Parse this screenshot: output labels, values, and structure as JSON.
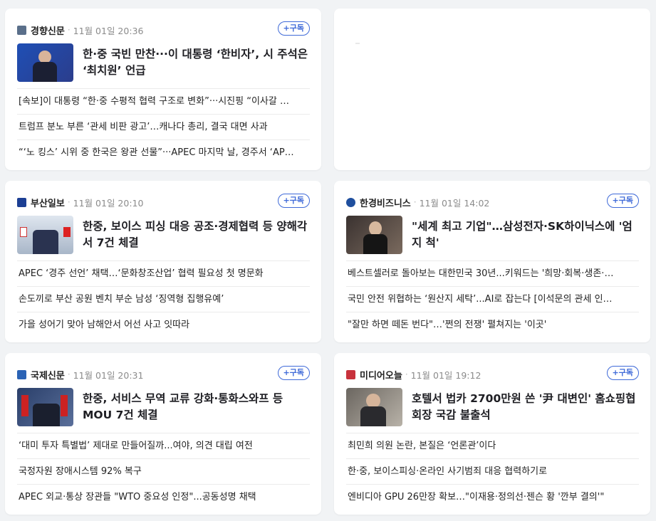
{
  "subscribe_label": "+구독",
  "cards": [
    {
      "press": "경향신문",
      "time": "11월 01일 20:36",
      "logo_color": "#5a6f8a",
      "thumb_colors": [
        "#1f4fb5",
        "#2b3d8c"
      ],
      "headline": "한·중 국빈 만찬···이 대통령 ‘한비자’, 시 주석은 ‘최치원’ 언급",
      "items": [
        "[속보]이 대통령 “한·중 수평적 협력 구조로 변화”···시진핑 “이사갈 …",
        "트럼프 분노 부른 ‘관세 비판 광고’…캐나다 총리, 결국 대면 사과",
        "“‘노 킹스’ 시위 중 한국은 왕관 선물”···APEC 마지막 날, 경주서 ‘AP…"
      ]
    },
    {
      "press": "부산일보",
      "time": "11월 01일 20:10",
      "logo_color": "#1c3f94",
      "thumb_colors": [
        "#dfe6ef",
        "#a8b6c8"
      ],
      "headline": "한중, 보이스 피싱 대응 공조·경제협력 등 양해각서 7건 체결",
      "items": [
        "APEC ‘경주 선언’ 채택…‘문화창조산업’ 협력 필요성 첫 명문화",
        "손도끼로 부산 공원 벤치 부순 남성 ‘징역형 집행유예’",
        "가을 성어기 맞아 남해안서 어선 사고 잇따라"
      ]
    },
    {
      "press": "한경비즈니스",
      "time": "11월 01일 14:02",
      "logo_color": "#1f4f9e",
      "thumb_colors": [
        "#3a3230",
        "#7a6a5e"
      ],
      "headline": "\"세계 최고 기업\"…삼성전자·SK하이닉스에 '엄지 척'",
      "items": [
        "베스트셀러로 돌아보는 대한민국 30년...키워드는 '희망·회복·생존·…",
        "국민 안전 위협하는 ‘원산지 세탁’...AI로 잡는다 [이석문의 관세 인…",
        "\"잘만 하면 떼돈 번다\"…'쩐의 전쟁' 펼쳐지는 '이곳'"
      ]
    },
    {
      "press": "국제신문",
      "time": "11월 01일 20:31",
      "logo_color": "#2b63b5",
      "thumb_colors": [
        "#2a3f6a",
        "#5a6f9a"
      ],
      "headline": "한중, 서비스 무역 교류 강화·통화스와프 등 MOU 7건 체결",
      "items": [
        "‘대미 투자 특별법’ 제대로 만들어질까...여야, 의견 대립 여전",
        "국정자원 장애시스템 92% 복구",
        "APEC 외교·통상 장관들 \"WTO 중요성 인정\"...공동성명 채택"
      ]
    },
    {
      "press": "미디어오늘",
      "time": "11월 01일 19:12",
      "logo_color": "#c8323c",
      "thumb_colors": [
        "#6b6660",
        "#b8b2a8"
      ],
      "headline": "호텔서 법카 2700만원 쓴 '尹 대변인' 홈쇼핑협회장 국감 불출석",
      "items": [
        "최민희 의원 논란, 본질은 ‘언론관’이다",
        "한·중, 보이스피싱·온라인 사기범죄 대응 협력하기로",
        "엔비디아 GPU 26만장 확보…\"이재용·정의선·젠슨 황 '깐부 결의'\""
      ]
    }
  ]
}
